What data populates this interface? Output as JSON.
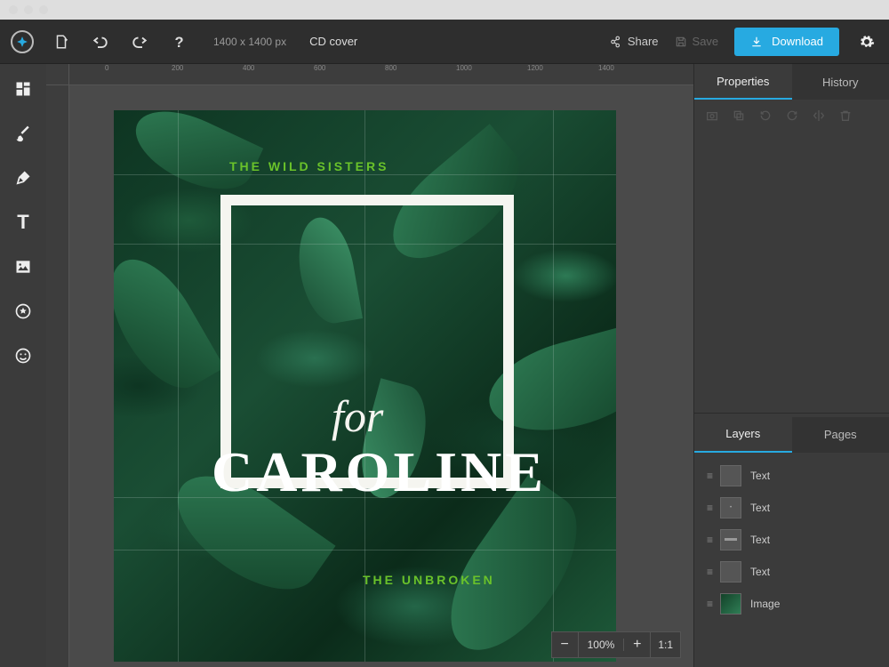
{
  "colors": {
    "accent": "#27aae1",
    "lime": "#6ac22a"
  },
  "document": {
    "dimensions": "1400 x 1400 px",
    "title": "CD cover"
  },
  "topbar": {
    "share": "Share",
    "save": "Save",
    "download": "Download"
  },
  "ruler": {
    "ticks_h": [
      "200",
      "400",
      "600",
      "800",
      "1000",
      "1200",
      "1400"
    ]
  },
  "canvas": {
    "top_text": "THE WILD SISTERS",
    "for_text": "for",
    "main_text": "CAROLINE",
    "bottom_text": "THE UNBROKEN"
  },
  "zoom": {
    "value": "100%",
    "ratio": "1:1"
  },
  "panel": {
    "tab_properties": "Properties",
    "tab_history": "History",
    "tab_layers": "Layers",
    "tab_pages": "Pages",
    "layers": [
      {
        "label": "Text",
        "type": "text"
      },
      {
        "label": "Text",
        "type": "text"
      },
      {
        "label": "Text",
        "type": "text"
      },
      {
        "label": "Text",
        "type": "text"
      },
      {
        "label": "Image",
        "type": "image"
      }
    ]
  }
}
